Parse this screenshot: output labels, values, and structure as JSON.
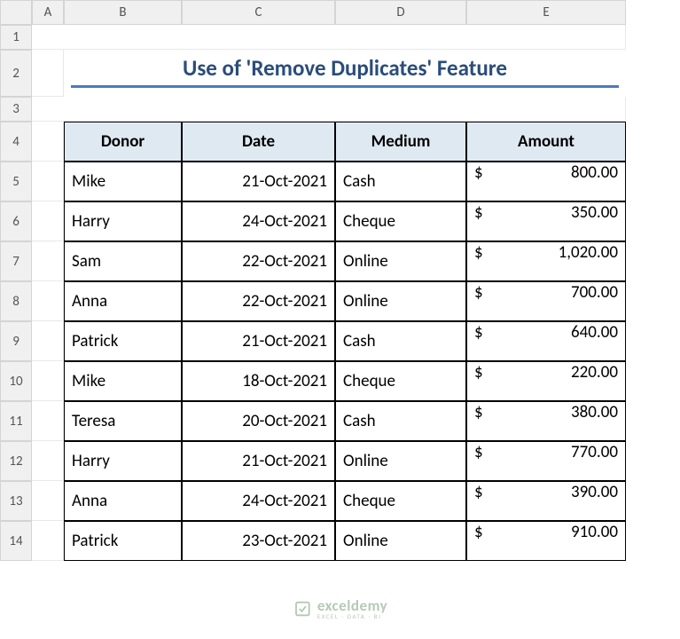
{
  "columns": [
    "A",
    "B",
    "C",
    "D",
    "E"
  ],
  "rows": [
    "1",
    "2",
    "3",
    "4",
    "5",
    "6",
    "7",
    "8",
    "9",
    "10",
    "11",
    "12",
    "13",
    "14"
  ],
  "title": "Use of 'Remove Duplicates' Feature",
  "headers": [
    "Donor",
    "Date",
    "Medium",
    "Amount"
  ],
  "data": [
    {
      "donor": "Mike",
      "date": "21-Oct-2021",
      "medium": "Cash",
      "currency": "$",
      "amount": "800.00"
    },
    {
      "donor": "Harry",
      "date": "24-Oct-2021",
      "medium": "Cheque",
      "currency": "$",
      "amount": "350.00"
    },
    {
      "donor": "Sam",
      "date": "22-Oct-2021",
      "medium": "Online",
      "currency": "$",
      "amount": "1,020.00"
    },
    {
      "donor": "Anna",
      "date": "22-Oct-2021",
      "medium": "Online",
      "currency": "$",
      "amount": "700.00"
    },
    {
      "donor": "Patrick",
      "date": "21-Oct-2021",
      "medium": "Cash",
      "currency": "$",
      "amount": "640.00"
    },
    {
      "donor": "Mike",
      "date": "18-Oct-2021",
      "medium": "Cheque",
      "currency": "$",
      "amount": "220.00"
    },
    {
      "donor": "Teresa",
      "date": "20-Oct-2021",
      "medium": "Cash",
      "currency": "$",
      "amount": "380.00"
    },
    {
      "donor": "Harry",
      "date": "21-Oct-2021",
      "medium": "Online",
      "currency": "$",
      "amount": "770.00"
    },
    {
      "donor": "Anna",
      "date": "24-Oct-2021",
      "medium": "Cheque",
      "currency": "$",
      "amount": "390.00"
    },
    {
      "donor": "Patrick",
      "date": "23-Oct-2021",
      "medium": "Online",
      "currency": "$",
      "amount": "910.00"
    }
  ],
  "watermark": {
    "name": "exceldemy",
    "sub": "EXCEL · DATA · BI"
  }
}
